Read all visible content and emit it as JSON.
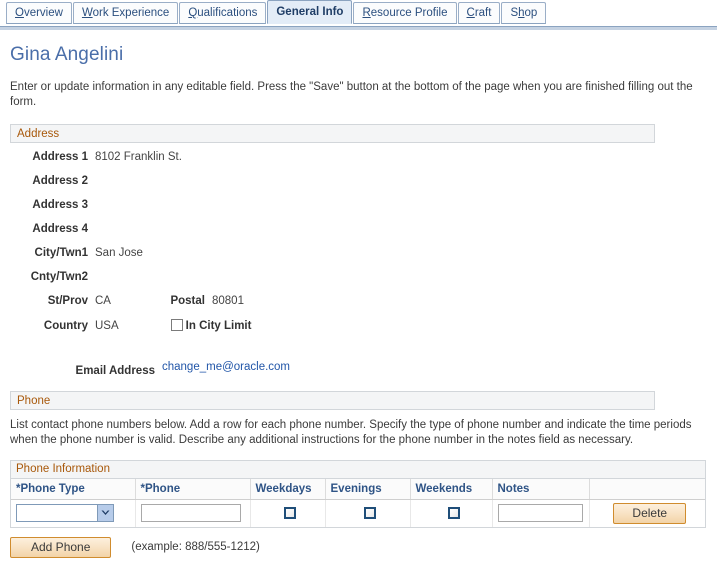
{
  "tabs": [
    {
      "label": "Overview",
      "accel_index": 0,
      "active": false
    },
    {
      "label": "Work Experience",
      "accel_index": 0,
      "active": false
    },
    {
      "label": "Qualifications",
      "accel_index": 0,
      "active": false
    },
    {
      "label": "General Info",
      "accel_index": -1,
      "active": true
    },
    {
      "label": "Resource Profile",
      "accel_index": 0,
      "active": false
    },
    {
      "label": "Craft",
      "accel_index": 0,
      "active": false
    },
    {
      "label": "Shop",
      "accel_index": 1,
      "active": false
    }
  ],
  "page": {
    "title": "Gina Angelini",
    "instructions": "Enter or update information in any editable field. Press the \"Save\" button at the bottom of the page when you are finished filling out the form."
  },
  "address": {
    "section_title": "Address",
    "fields": [
      {
        "label": "Address 1",
        "value": "8102 Franklin St."
      },
      {
        "label": "Address 2",
        "value": ""
      },
      {
        "label": "Address 3",
        "value": ""
      },
      {
        "label": "Address 4",
        "value": ""
      },
      {
        "label": "City/Twn1",
        "value": "San Jose"
      },
      {
        "label": "Cnty/Twn2",
        "value": ""
      }
    ],
    "state_label": "St/Prov",
    "state_value": "CA",
    "postal_label": "Postal",
    "postal_value": "80801",
    "country_label": "Country",
    "country_value": "USA",
    "in_city_limit_label": "In City Limit",
    "in_city_limit_checked": false,
    "email_label": "Email Address",
    "email_value": "change_me@oracle.com"
  },
  "phone": {
    "section_title": "Phone",
    "instructions": "List contact phone numbers below. Add a row for each phone number. Specify the type of phone number and indicate the time periods when the phone number is valid. Describe any additional instructions for the phone number in the notes field as necessary.",
    "grid_title": "Phone Information",
    "columns": [
      "*Phone Type",
      "*Phone",
      "Weekdays",
      "Evenings",
      "Weekends",
      "Notes",
      ""
    ],
    "rows": [
      {
        "phone_type": "",
        "phone": "",
        "weekdays": false,
        "evenings": false,
        "weekends": false,
        "notes": "",
        "delete_label": "Delete"
      }
    ],
    "add_button_label": "Add Phone",
    "example_text": "(example: 888/555-1212)"
  },
  "colors": {
    "section_header_text": "#a8580a",
    "column_header_text": "#2f5486",
    "page_title": "#4a6ea9",
    "link": "#2256a8",
    "button_border": "#d08c2e",
    "active_tab_bg": "#e3ecf7"
  },
  "icons": {
    "chevron_down": "chevron-down-icon"
  }
}
